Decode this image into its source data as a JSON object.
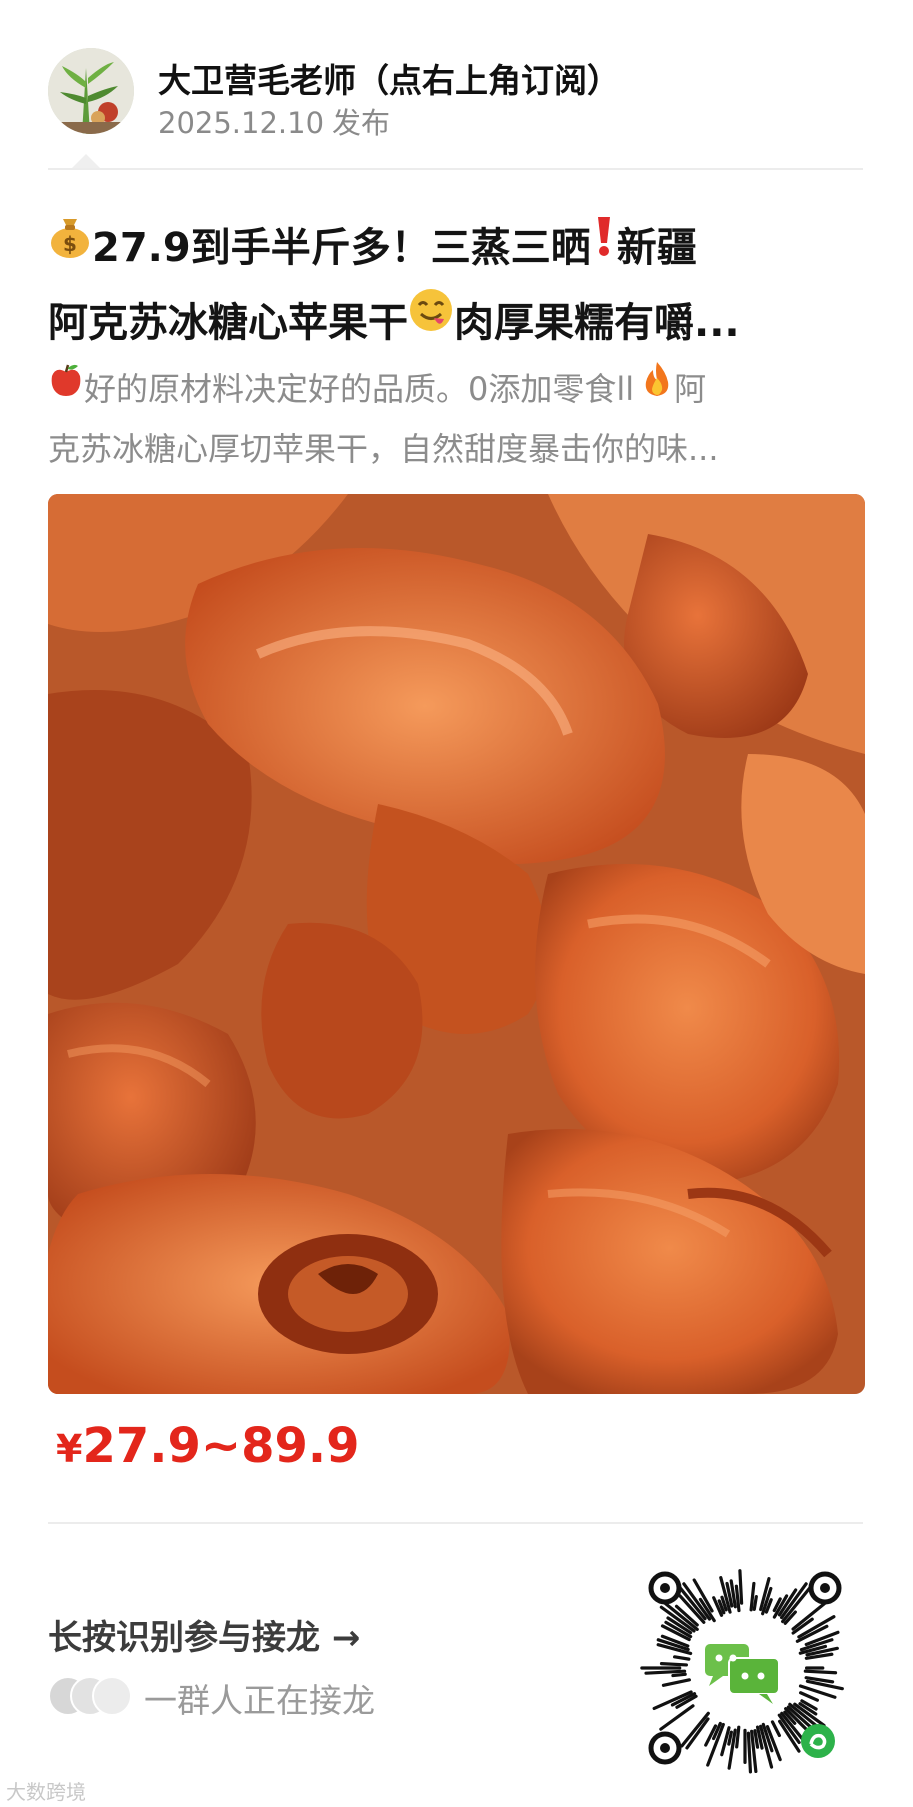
{
  "author": {
    "name": "大卫营毛老师（点右上角订阅）",
    "date": "2025.12.10",
    "date_suffix": "发布"
  },
  "article": {
    "title_line1": "27.9到手半斤多！三蒸三晒",
    "title_line1b": "新疆",
    "title_line2": "阿克苏冰糖心苹果干",
    "title_line2b": "肉厚果糯有嚼...",
    "desc_line1": "好的原材料决定好的品质。0添加零食ll",
    "desc_line1b": "阿",
    "desc_line2": "克苏冰糖心厚切苹果干，自然甜度暴击你的味..."
  },
  "product": {
    "currency": "¥",
    "price": "27.9~89.9"
  },
  "solitaire": {
    "title": "长按识别参与接龙",
    "arrow": "→",
    "subtitle": "一群人正在接龙"
  },
  "watermark": "大数跨境",
  "icons": [
    "money-bag-icon",
    "exclamation-icon",
    "yum-face-icon",
    "apple-icon",
    "fire-icon",
    "arrow-right-icon",
    "mini-program-qr-icon",
    "wechat-chat-icon"
  ],
  "colors": {
    "price": "#e3261b",
    "title": "#141414",
    "muted": "#8c8c8c",
    "divider": "#ececec"
  }
}
